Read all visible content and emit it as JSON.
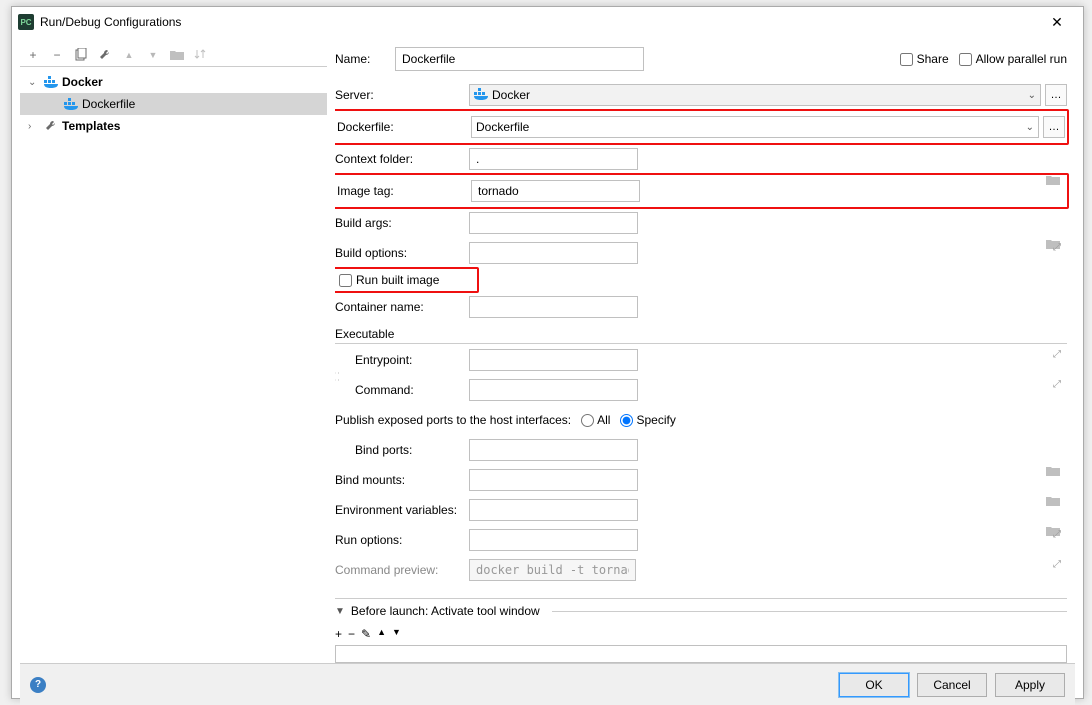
{
  "window": {
    "title": "Run/Debug Configurations"
  },
  "toolbar_icons": {
    "add": "+",
    "remove": "−",
    "copy": "⧉",
    "edit": "🔧",
    "up": "▲",
    "down": "▼",
    "folder": "📁",
    "sort": "⇵"
  },
  "tree": {
    "docker": {
      "label": "Docker",
      "expanded": true
    },
    "dockerfile_item": {
      "label": "Dockerfile"
    },
    "templates": {
      "label": "Templates"
    }
  },
  "form": {
    "name_label": "Name:",
    "name_value": "Dockerfile",
    "share_label": "Share",
    "allow_parallel_label": "Allow parallel run",
    "server_label": "Server:",
    "server_value": "Docker",
    "dockerfile_label": "Dockerfile:",
    "dockerfile_value": "Dockerfile",
    "context_folder_label": "Context folder:",
    "context_folder_value": ".",
    "image_tag_label": "Image tag:",
    "image_tag_value": "tornado",
    "build_args_label": "Build args:",
    "build_args_value": "",
    "build_options_label": "Build options:",
    "build_options_value": "",
    "run_built_image_label": "Run built image",
    "container_name_label": "Container name:",
    "container_name_value": "",
    "executable_label": "Executable",
    "entrypoint_label": "Entrypoint:",
    "entrypoint_value": "",
    "command_label": "Command:",
    "command_value": "",
    "publish_ports_label": "Publish exposed ports to the host interfaces:",
    "all_label": "All",
    "specify_label": "Specify",
    "bind_ports_label": "Bind ports:",
    "bind_ports_value": "",
    "bind_mounts_label": "Bind mounts:",
    "bind_mounts_value": "",
    "env_vars_label": "Environment variables:",
    "env_vars_value": "",
    "run_options_label": "Run options:",
    "run_options_value": "",
    "command_preview_label": "Command preview:",
    "command_preview_value": "docker build -t tornado ."
  },
  "before_launch": {
    "title": "Before launch: Activate tool window"
  },
  "buttons": {
    "ok": "OK",
    "cancel": "Cancel",
    "apply": "Apply"
  }
}
